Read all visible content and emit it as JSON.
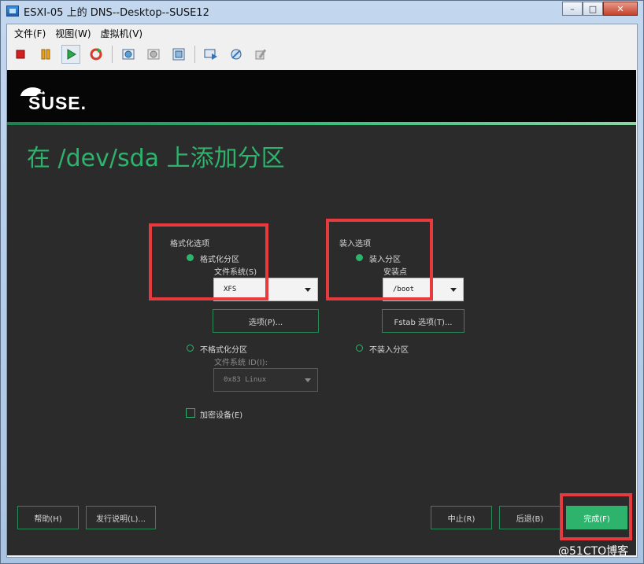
{
  "window": {
    "title": "ESXI-05 上的 DNS--Desktop--SUSE12",
    "controls": {
      "minimize": "–",
      "maximize": "□",
      "close": "✕"
    }
  },
  "menubar": [
    "文件(F)",
    "视图(W)",
    "虚拟机(V)"
  ],
  "toolbar_icons": [
    "stop-icon",
    "pause-icon",
    "play-icon",
    "reset-icon",
    "snapshot-icon",
    "revert-snapshot-icon",
    "manage-snapshots-icon",
    "console-settings-icon",
    "vm-settings-icon",
    "edit-settings-icon"
  ],
  "logo": {
    "text": "SUSE."
  },
  "page_title": "在 /dev/sda 上添加分区",
  "format_options": {
    "heading": "格式化选项",
    "format_partition": "格式化分区",
    "filesystem_label": "文件系统(S)",
    "filesystem_value": "XFS",
    "options_button": "选项(P)...",
    "no_format_partition": "不格式化分区",
    "fs_id_label": "文件系统 ID(I):",
    "fs_id_value": "0x83 Linux",
    "encrypt_label": "加密设备(E)"
  },
  "mount_options": {
    "heading": "装入选项",
    "mount_partition": "装入分区",
    "mount_point_label": "安装点",
    "mount_point_value": "/boot",
    "fstab_button": "Fstab 选项(T)...",
    "no_mount_partition": "不装入分区"
  },
  "footer": {
    "help": "帮助(H)",
    "release_notes": "发行说明(L)...",
    "abort": "中止(R)",
    "back": "后退(B)",
    "finish": "完成(F)"
  },
  "watermark": "@51CTO博客",
  "colors": {
    "accent": "#2db36c",
    "highlight": "#e63a3f",
    "background": "#2b2b2b"
  }
}
